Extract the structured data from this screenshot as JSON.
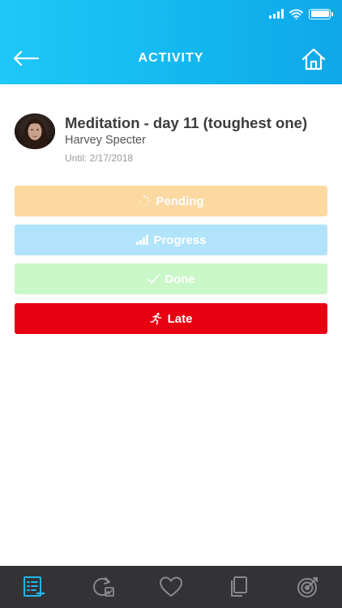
{
  "header": {
    "title": "ACTIVITY",
    "back_icon": "arrow-left-icon",
    "home_icon": "home-icon",
    "gradient": [
      "#1ec8f7",
      "#0fa7e9"
    ]
  },
  "status_bar": {
    "signal_icon": "cellular-signal-icon",
    "wifi_icon": "wifi-icon",
    "battery_icon": "battery-icon",
    "battery_level": 1.0
  },
  "activity": {
    "title": "Meditation - day 11 (toughest one)",
    "person": "Harvey Specter",
    "until": "Until: 2/17/2018"
  },
  "status_buttons": [
    {
      "label": "Pending",
      "icon": "spinner-icon",
      "color": "#fbd9a1"
    },
    {
      "label": "Progress",
      "icon": "bar-chart-icon",
      "color": "#b1e3fb"
    },
    {
      "label": "Done",
      "icon": "checkmark-icon",
      "color": "#c9f7c7"
    },
    {
      "label": "Late",
      "icon": "running-person-icon",
      "color": "#e60012"
    }
  ],
  "tabbar": {
    "active_index": 0,
    "active_color": "#1fb5ec",
    "inactive_color": "#8a8a8e",
    "tabs": [
      {
        "icon": "tasks-list-icon"
      },
      {
        "icon": "refresh-check-icon"
      },
      {
        "icon": "heart-icon"
      },
      {
        "icon": "copy-icon"
      },
      {
        "icon": "target-icon"
      }
    ]
  }
}
